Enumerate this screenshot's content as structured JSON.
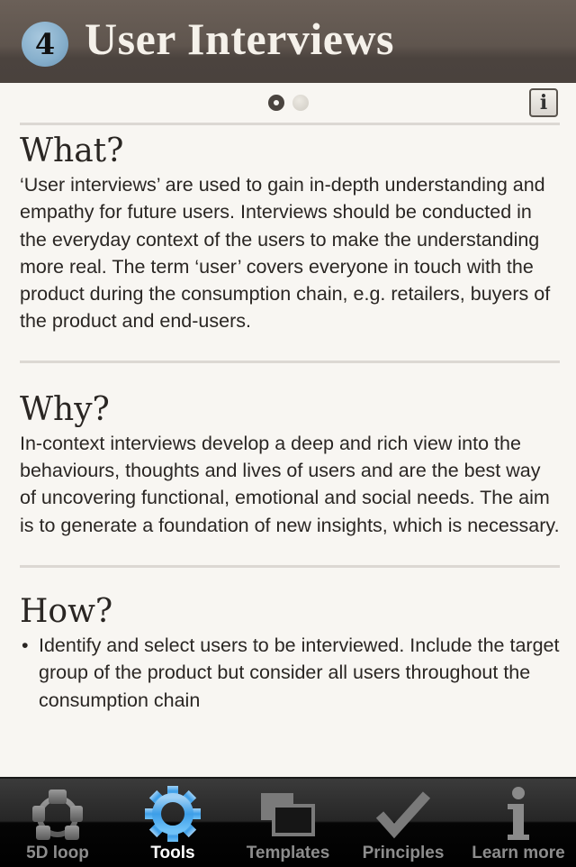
{
  "header": {
    "step_number": "4",
    "title": "User Interviews"
  },
  "pager": {
    "current_page": 1,
    "total_pages": 2
  },
  "info_button": {
    "icon": "info-icon",
    "label": "i"
  },
  "sections": [
    {
      "heading": "What?",
      "body": "‘User interviews’ are used to gain in-depth understand­ing and empathy for future users. Interviews should be conducted in the everyday context of the users to make the understanding more real. The term ‘user’ covers everyone in touch with the product during the consump­tion chain, e.g. retailers, buyers of the product and end-users."
    },
    {
      "heading": "Why?",
      "body": "In-context interviews develop a deep and rich view into the behaviours, thoughts and lives of users and are the best way of uncovering functional, emotional and social needs. The aim is to generate a foundation of new insights, which is necessary."
    },
    {
      "heading": "How?",
      "bullets": [
        "Identify and select users to be interviewed. Include the target group of the product but consider all users throughout the consumption chain"
      ]
    }
  ],
  "tabbar": {
    "active": "Tools",
    "items": [
      {
        "label": "5D loop",
        "icon": "loop-icon"
      },
      {
        "label": "Tools",
        "icon": "gear-icon"
      },
      {
        "label": "Templates",
        "icon": "templates-icon"
      },
      {
        "label": "Principles",
        "icon": "checkmark-icon"
      },
      {
        "label": "Learn more",
        "icon": "info-icon"
      }
    ],
    "colors": {
      "active_tint": "#3d9ee8",
      "inactive_tint": "#8d8d8d"
    }
  }
}
